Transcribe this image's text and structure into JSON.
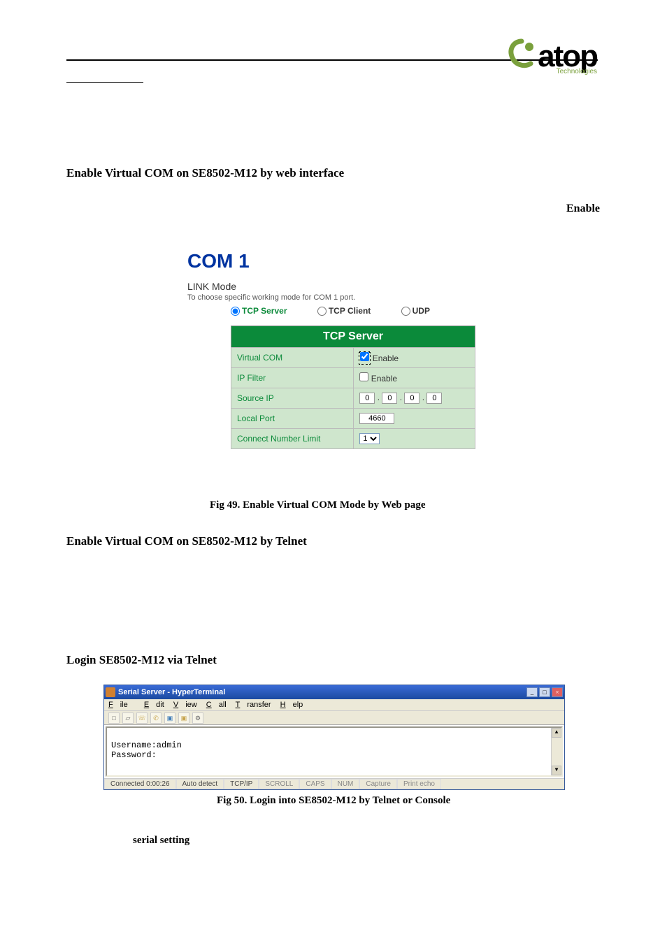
{
  "logo": {
    "text": "atop",
    "sub": "Technologies"
  },
  "sections": {
    "enable_web_title": "Enable Virtual COM on SE8502-M12 by web interface",
    "enable_right": "Enable",
    "enable_telnet_title": "Enable Virtual COM on SE8502-M12 by Telnet",
    "login_telnet_title": "Login SE8502-M12 via Telnet",
    "serial_setting": "serial setting"
  },
  "fig49": {
    "com_title": "COM 1",
    "link_mode_label": "LINK Mode",
    "link_desc": "To choose specific working mode for COM 1 port.",
    "radios": {
      "tcp_server": "TCP Server",
      "tcp_client": "TCP Client",
      "udp": "UDP"
    },
    "table_header": "TCP Server",
    "rows": {
      "virtual_com": {
        "label": "Virtual COM",
        "enable_label": "Enable",
        "checked": true
      },
      "ip_filter": {
        "label": "IP Filter",
        "enable_label": "Enable",
        "checked": false
      },
      "source_ip": {
        "label": "Source IP",
        "octets": [
          "0",
          "0",
          "0",
          "0"
        ]
      },
      "local_port": {
        "label": "Local Port",
        "value": "4660"
      },
      "conn_limit": {
        "label": "Connect Number Limit",
        "value": "1"
      }
    },
    "caption": "Fig 49. Enable Virtual COM Mode by Web page"
  },
  "fig50": {
    "window_title": "Serial Server - HyperTerminal",
    "menu": {
      "file": "File",
      "edit": "Edit",
      "view": "View",
      "call": "Call",
      "transfer": "Transfer",
      "help": "Help"
    },
    "body_line1": "Username:admin",
    "body_line2": "Password:",
    "status": {
      "connected": "Connected 0:00:26",
      "detect": "Auto detect",
      "proto": "TCP/IP",
      "scroll": "SCROLL",
      "caps": "CAPS",
      "num": "NUM",
      "capture": "Capture",
      "echo": "Print echo"
    },
    "caption": "Fig 50. Login into SE8502-M12 by Telnet or Console"
  }
}
